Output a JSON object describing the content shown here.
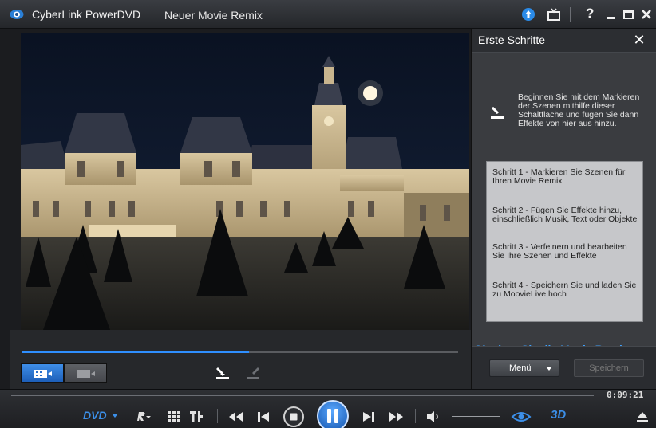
{
  "titlebar": {
    "app_name": "CyberLink PowerDVD",
    "document_name": "Neuer Movie Remix",
    "help_label": "?",
    "icons": [
      "powerdvd-logo-icon",
      "upgrade-icon",
      "tv-mode-icon",
      "minimize-icon",
      "maximize-icon",
      "close-icon"
    ]
  },
  "panel": {
    "title": "Erste Schritte",
    "close_label": "✕",
    "intro": "Beginnen Sie mit dem Markieren der Szenen mithilfe dieser Schaltfläche und fügen Sie dann Effekte von hier aus hinzu.",
    "steps": [
      "Schritt 1 - Markieren Sie Szenen für Ihren Movie Remix",
      "Schritt 2 - Fügen Sie Effekte hinzu, einschließlich Musik, Text oder Objekte",
      "Schritt 3 - Verfeinern und bearbeiten Sie Ihre Szenen und Effekte",
      "Schritt 4 - Speichern Sie und laden Sie zu MoovieLive hoch"
    ],
    "remix_link": "Machen Sie die Movie Remix...",
    "menu_button": "Menü",
    "save_button": "Speichern"
  },
  "editor": {
    "progress": 0.52
  },
  "playback": {
    "time": "0:09:21",
    "dvd_label": "DVD",
    "three_d_label": "3D"
  },
  "colors": {
    "accent": "#2f8fff",
    "link": "#3fa2ff"
  }
}
